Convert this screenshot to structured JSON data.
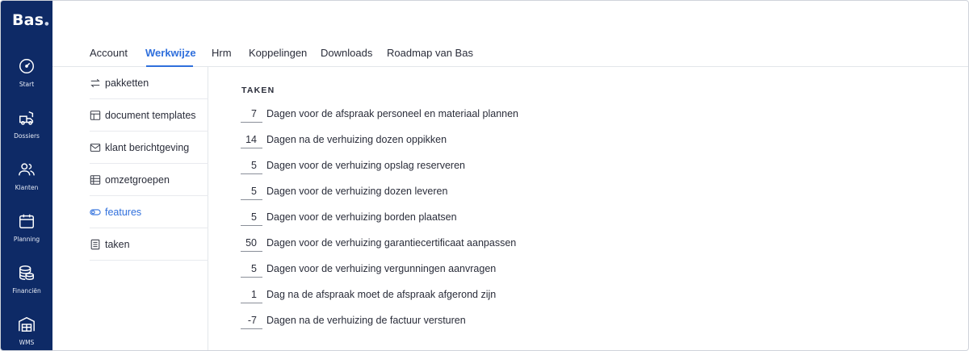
{
  "brand": "Bas",
  "nav": {
    "items": [
      {
        "label": "Start"
      },
      {
        "label": "Dossiers"
      },
      {
        "label": "Klanten"
      },
      {
        "label": "Planning"
      },
      {
        "label": "Financiën"
      },
      {
        "label": "WMS"
      }
    ]
  },
  "tabs": [
    "Account",
    "Werkwijze",
    "Hrm",
    "Koppelingen",
    "Downloads",
    "Roadmap van Bas"
  ],
  "active_tab": "Werkwijze",
  "side_menu": {
    "items": [
      {
        "label": "pakketten"
      },
      {
        "label": "document templates"
      },
      {
        "label": "klant berichtgeving"
      },
      {
        "label": "omzetgroepen"
      },
      {
        "label": "features"
      },
      {
        "label": "taken"
      }
    ],
    "active": "features"
  },
  "content": {
    "section_title": "TAKEN",
    "tasks": [
      {
        "value": "7",
        "text": "Dagen voor de afspraak personeel en materiaal plannen"
      },
      {
        "value": "14",
        "text": "Dagen na de verhuizing dozen oppikken"
      },
      {
        "value": "5",
        "text": "Dagen voor de verhuizing opslag reserveren"
      },
      {
        "value": "5",
        "text": "Dagen voor de verhuizing dozen leveren"
      },
      {
        "value": "5",
        "text": "Dagen voor de verhuizing borden plaatsen"
      },
      {
        "value": "50",
        "text": "Dagen voor de verhuizing garantiecertificaat aanpassen"
      },
      {
        "value": "5",
        "text": "Dagen voor de verhuizing vergunningen aanvragen"
      },
      {
        "value": "1",
        "text": "Dag na de afspraak moet de afspraak afgerond zijn"
      },
      {
        "value": "-7",
        "text": "Dagen na de verhuizing de factuur versturen"
      }
    ]
  },
  "colors": {
    "nav_bg": "#0e2a66",
    "accent": "#2f6fdc"
  }
}
